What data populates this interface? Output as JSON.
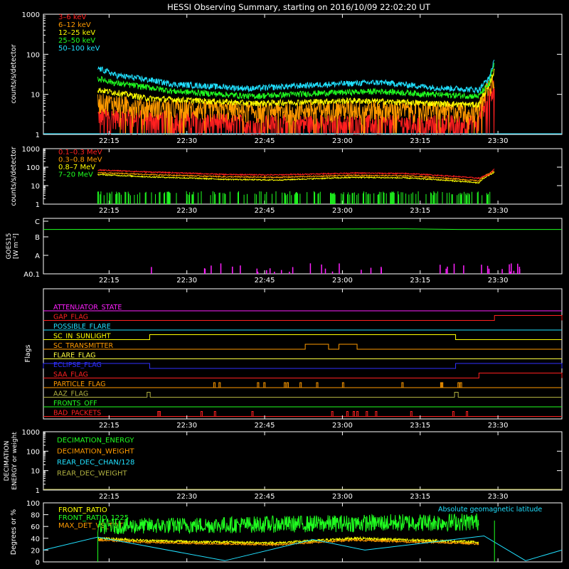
{
  "title": "HESSI Observing Summary, starting on 2016/10/09 22:02:20 UT",
  "time_axis": {
    "start_minutes": 0,
    "end_minutes": 100,
    "ticks": [
      {
        "label": "22:15",
        "minute": 12.67
      },
      {
        "label": "22:30",
        "minute": 27.67
      },
      {
        "label": "22:45",
        "minute": 42.67
      },
      {
        "label": "23:00",
        "minute": 57.67
      },
      {
        "label": "23:15",
        "minute": 72.67
      },
      {
        "label": "23:30",
        "minute": 87.67
      }
    ]
  },
  "panels": {
    "hxr": {
      "ylabel": "counts/s/detector",
      "yticks": [
        "1",
        "10",
        "100",
        "1000"
      ],
      "legend": [
        {
          "name": "3–6 keV",
          "color": "#ff2020"
        },
        {
          "name": "6–12 keV",
          "color": "#ff9a00"
        },
        {
          "name": "12–25 keV",
          "color": "#ffff00"
        },
        {
          "name": "25–50 keV",
          "color": "#20ff20"
        },
        {
          "name": "50–100 keV",
          "color": "#20e0ff"
        }
      ]
    },
    "gamma": {
      "ylabel": "counts/s/detector",
      "yticks": [
        "1",
        "10",
        "100",
        "1000"
      ],
      "legend": [
        {
          "name": "0.1–0.3 MeV",
          "color": "#ff2020"
        },
        {
          "name": "0.3–0.8 MeV",
          "color": "#ff9a00"
        },
        {
          "name": "0.8–7 MeV",
          "color": "#ffff00"
        },
        {
          "name": "7–20 MeV",
          "color": "#20ff20"
        }
      ]
    },
    "goes": {
      "ylabel_top": "GOES15",
      "ylabel_bottom": "[W m⁻²]",
      "yticks": [
        "A0.1",
        "A",
        "B",
        "C"
      ],
      "colors": {
        "goes": "#20ff20",
        "spikes": "#ff20ff"
      }
    },
    "flags": {
      "ylabel": "Flags",
      "items": [
        {
          "name": "ATTENUATOR_STATE",
          "color": "#ff20ff"
        },
        {
          "name": "GAP_FLAG",
          "color": "#ff2020"
        },
        {
          "name": "POSSIBLE_FLARE",
          "color": "#20e0ff"
        },
        {
          "name": "SC_IN_SUNLIGHT",
          "color": "#ffff00"
        },
        {
          "name": "SC_TRANSMITTER",
          "color": "#ff9a00"
        },
        {
          "name": "FLARE_FLAG",
          "color": "#ffff40"
        },
        {
          "name": "ECLIPSE_FLAG",
          "color": "#3030ff"
        },
        {
          "name": "SAA_FLAG",
          "color": "#ff2020"
        },
        {
          "name": "PARTICLE_FLAG",
          "color": "#ff9a00"
        },
        {
          "name": "AAZ_FLAG",
          "color": "#b0b040"
        },
        {
          "name": "FRONTS_OFF",
          "color": "#20ff20"
        },
        {
          "name": "BAD_PACKETS",
          "color": "#ff2020"
        }
      ]
    },
    "decimation": {
      "ylabel_top": "DECIMATION",
      "ylabel_bottom": "ENERGY or weight",
      "yticks": [
        "1",
        "10",
        "100",
        "1000"
      ],
      "legend": [
        {
          "name": "DECIMATION_ENERGY",
          "color": "#20ff20"
        },
        {
          "name": "DECIMATION_WEIGHT",
          "color": "#ff9a00"
        },
        {
          "name": "REAR_DEC_CHAN/128",
          "color": "#20e0ff"
        },
        {
          "name": "REAR_DEC_WEIGHT",
          "color": "#b0b040"
        }
      ]
    },
    "ratio": {
      "ylabel": "Degrees or %",
      "yticks": [
        "0",
        "20",
        "40",
        "60",
        "80",
        "100"
      ],
      "legend": [
        {
          "name": "FRONT_RATIO",
          "color": "#ffff00"
        },
        {
          "name": "FRONT_RATIO_1225",
          "color": "#20ff20"
        },
        {
          "name": "MAX_DET_VS_TOT",
          "color": "#ff9a00"
        }
      ],
      "right_label": {
        "name": "Absolute geomagnetic latitude",
        "color": "#20e0ff"
      }
    }
  },
  "chart_data": {
    "type": "line",
    "hxr_levels": [
      {
        "series": "50–100 keV",
        "points": [
          [
            10.5,
            45
          ],
          [
            14,
            30
          ],
          [
            25,
            18
          ],
          [
            40,
            14
          ],
          [
            55,
            18
          ],
          [
            65,
            20
          ],
          [
            75,
            15
          ],
          [
            84,
            13
          ],
          [
            86,
            25
          ],
          [
            87,
            65
          ]
        ]
      },
      {
        "series": "25–50 keV",
        "points": [
          [
            10.5,
            25
          ],
          [
            14,
            19
          ],
          [
            25,
            12
          ],
          [
            40,
            9
          ],
          [
            55,
            11
          ],
          [
            65,
            12
          ],
          [
            75,
            10
          ],
          [
            84,
            9
          ],
          [
            86,
            18
          ],
          [
            87,
            55
          ]
        ]
      },
      {
        "series": "12–25 keV",
        "points": [
          [
            10.5,
            13
          ],
          [
            20,
            8
          ],
          [
            40,
            6
          ],
          [
            60,
            7
          ],
          [
            75,
            6
          ],
          [
            84,
            5.5
          ],
          [
            86,
            15
          ],
          [
            87,
            40
          ]
        ]
      },
      {
        "series": "6–12 keV",
        "points": [
          [
            10.5,
            7
          ],
          [
            20,
            5
          ],
          [
            40,
            4
          ],
          [
            60,
            4.5
          ],
          [
            84,
            4
          ],
          [
            87,
            25
          ]
        ]
      },
      {
        "series": "3–6 keV",
        "points": [
          [
            10.5,
            3
          ],
          [
            40,
            2
          ],
          [
            84,
            2
          ],
          [
            87,
            15
          ]
        ]
      }
    ],
    "gamma_levels": [
      {
        "series": "0.1–0.3 MeV",
        "points": [
          [
            10.5,
            70
          ],
          [
            20,
            55
          ],
          [
            35,
            40
          ],
          [
            45,
            38
          ],
          [
            60,
            48
          ],
          [
            70,
            45
          ],
          [
            84,
            25
          ],
          [
            86,
            40
          ],
          [
            87,
            80
          ]
        ]
      },
      {
        "series": "0.3–0.8 MeV",
        "points": [
          [
            10.5,
            50
          ],
          [
            20,
            40
          ],
          [
            35,
            30
          ],
          [
            45,
            28
          ],
          [
            60,
            36
          ],
          [
            70,
            34
          ],
          [
            84,
            18
          ],
          [
            87,
            60
          ]
        ]
      },
      {
        "series": "0.8–7 MeV",
        "points": [
          [
            10.5,
            40
          ],
          [
            20,
            30
          ],
          [
            35,
            22
          ],
          [
            45,
            20
          ],
          [
            60,
            28
          ],
          [
            70,
            26
          ],
          [
            84,
            14
          ],
          [
            87,
            50
          ]
        ]
      }
    ],
    "goes_level": [
      [
        0,
        0.8
      ],
      [
        70,
        0.81
      ],
      [
        80,
        0.8
      ],
      [
        100,
        0.8
      ]
    ],
    "flags_timeline": [
      {
        "flag": "GAP_FLAG",
        "high": [
          [
            87,
            100
          ]
        ]
      },
      {
        "flag": "SC_IN_SUNLIGHT",
        "high": [
          [
            20.5,
            79.5
          ]
        ]
      },
      {
        "flag": "SC_TRANSMITTER",
        "high": [
          [
            50.5,
            55
          ],
          [
            57,
            60.5
          ]
        ]
      },
      {
        "flag": "ECLIPSE_FLAG",
        "high": [
          [
            0,
            20.5
          ],
          [
            79.5,
            100
          ]
        ]
      },
      {
        "flag": "SAA_FLAG",
        "high": [
          [
            84,
            100
          ]
        ]
      },
      {
        "flag": "AAZ_FLAG",
        "high": [
          [
            20,
            20.6
          ],
          [
            79.3,
            80
          ]
        ]
      }
    ],
    "ratio_levels": {
      "FRONT_RATIO": [
        [
          10.5,
          40
        ],
        [
          20,
          36
        ],
        [
          30,
          34
        ],
        [
          45,
          32
        ],
        [
          60,
          40
        ],
        [
          70,
          37
        ],
        [
          80,
          35
        ],
        [
          84,
          33
        ]
      ],
      "FRONT_RATIO_1225": [
        [
          10.5,
          60
        ],
        [
          84,
          68
        ]
      ],
      "geomag_latitude": [
        [
          0,
          20
        ],
        [
          10.5,
          42
        ],
        [
          35,
          2
        ],
        [
          52,
          38
        ],
        [
          62,
          20
        ],
        [
          85,
          44
        ],
        [
          93,
          2
        ],
        [
          100,
          20
        ]
      ]
    }
  }
}
